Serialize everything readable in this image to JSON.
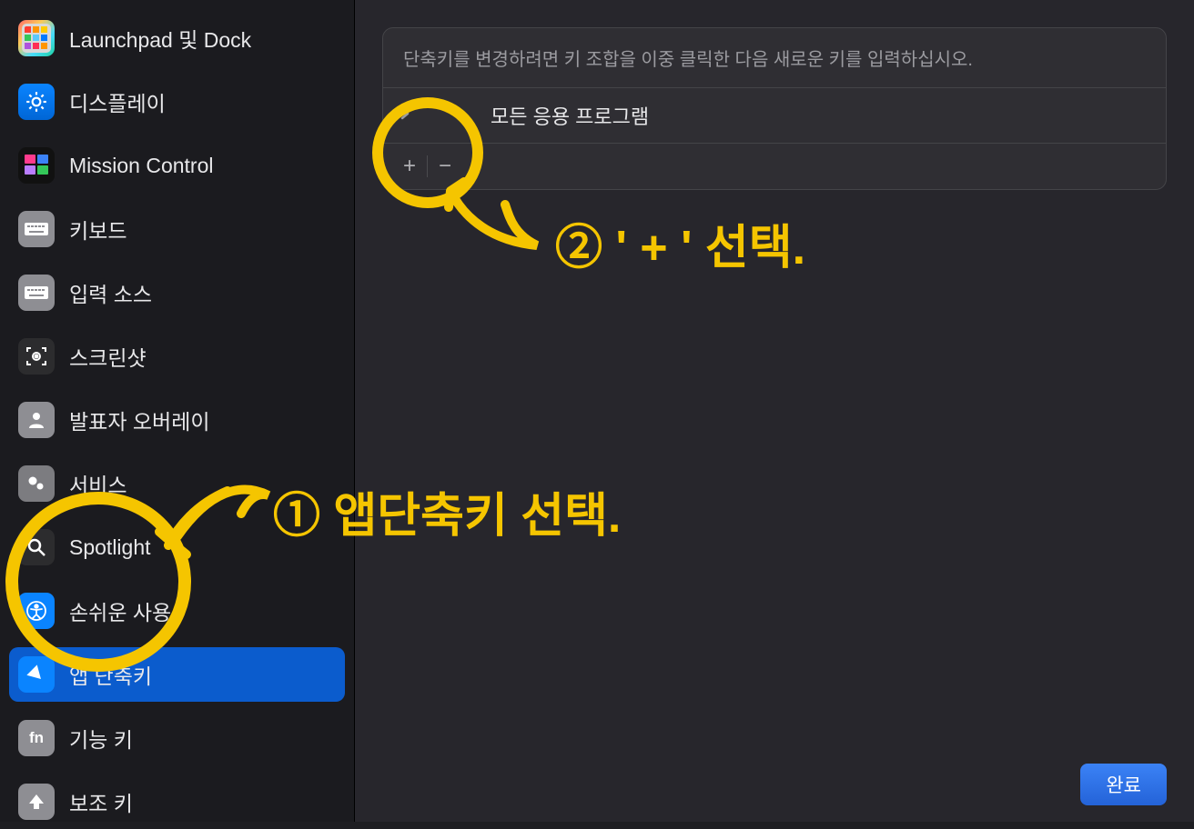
{
  "sidebar": {
    "items": [
      {
        "label": "Launchpad 및 Dock"
      },
      {
        "label": "디스플레이"
      },
      {
        "label": "Mission Control"
      },
      {
        "label": "키보드"
      },
      {
        "label": "입력 소스"
      },
      {
        "label": "스크린샷"
      },
      {
        "label": "발표자 오버레이"
      },
      {
        "label": "서비스"
      },
      {
        "label": "Spotlight"
      },
      {
        "label": "손쉬운 사용"
      },
      {
        "label": "앱 단축키"
      },
      {
        "label": "기능 키"
      },
      {
        "label": "보조 키"
      }
    ]
  },
  "panel": {
    "instruction": "단축키를 변경하려면 키 조합을 이중 클릭한 다음 새로운 키를 입력하십시오.",
    "row_label": "모든 응용 프로그램",
    "add_symbol": "+",
    "remove_symbol": "−"
  },
  "footer": {
    "done_label": "완료"
  },
  "annotations": {
    "step1_text": "① 앱단축키 선택.",
    "step2_text": "② ' + ' 선택."
  },
  "fn_label": "fn"
}
